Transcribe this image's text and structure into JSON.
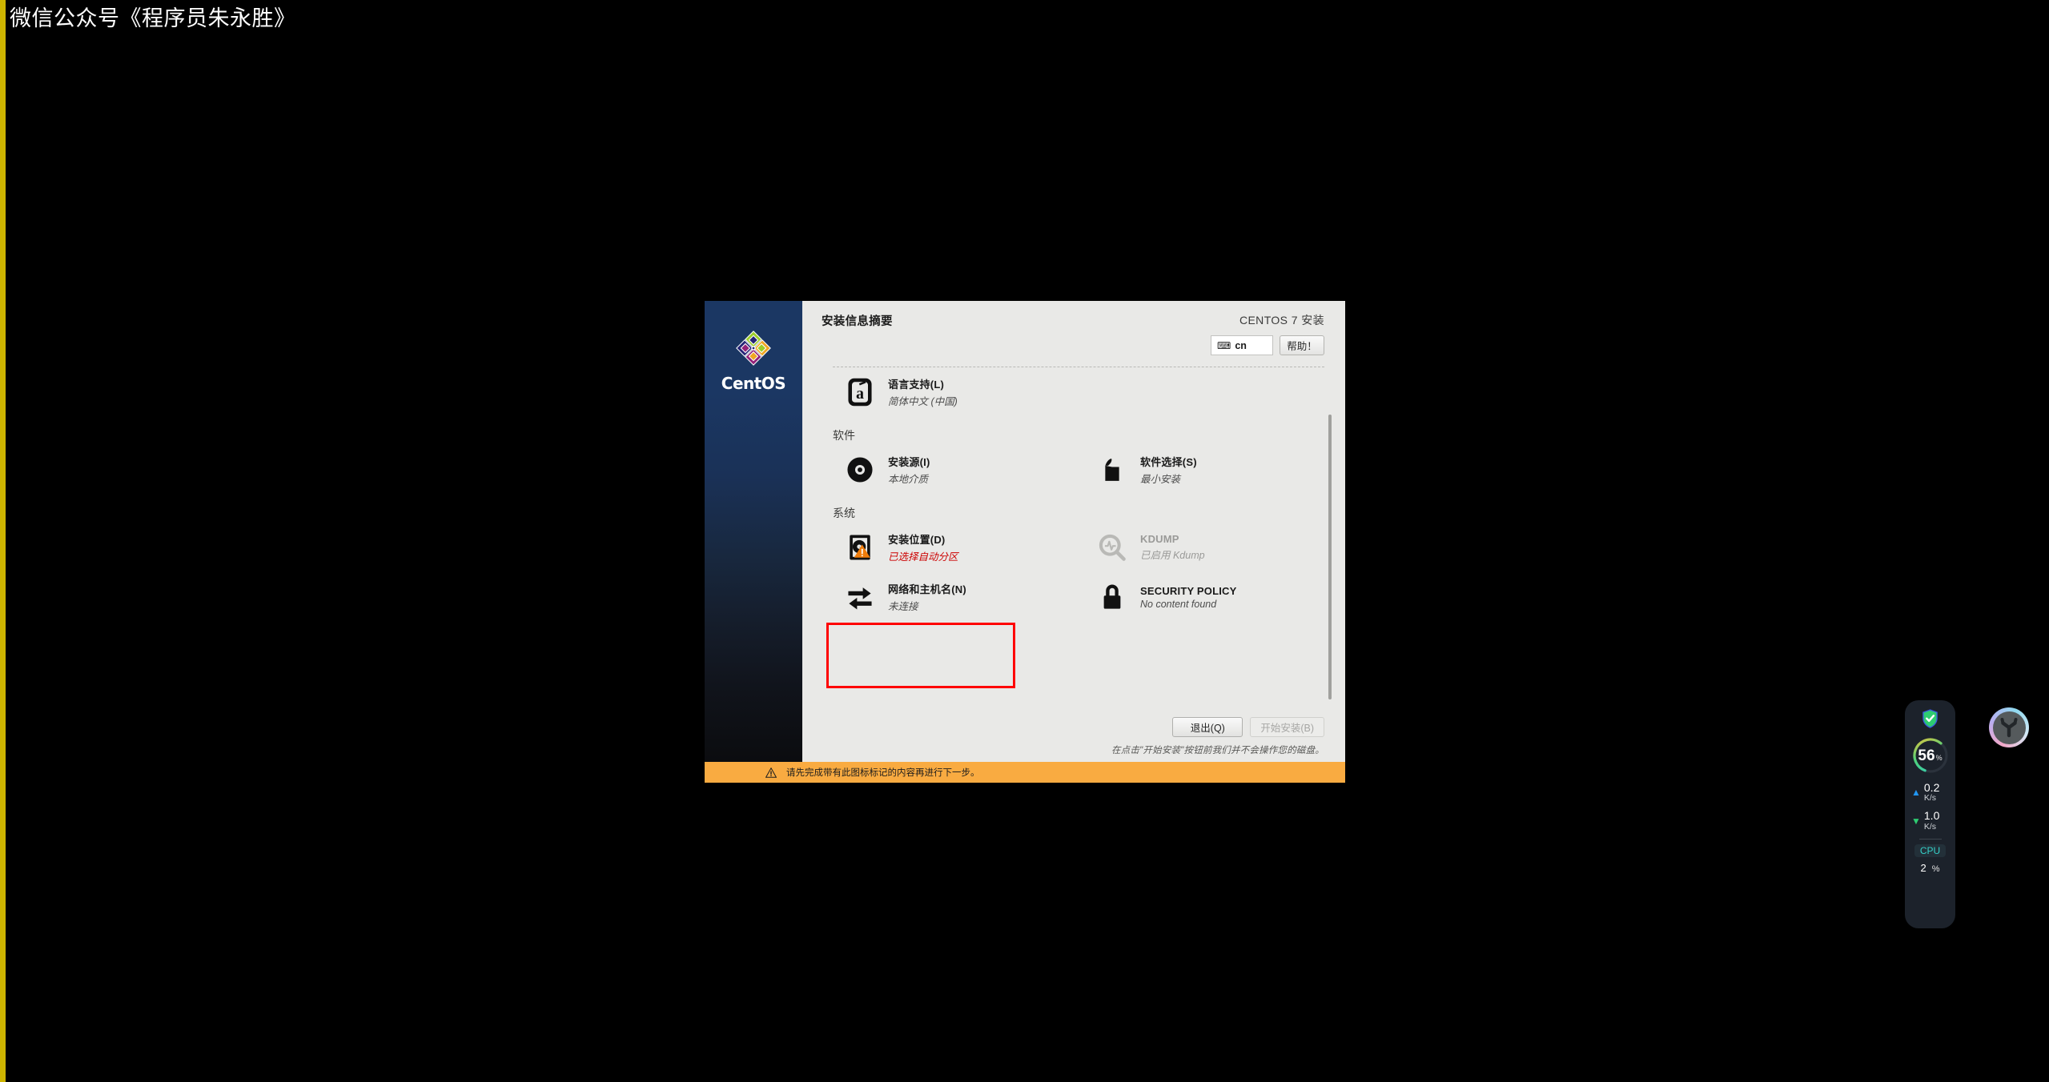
{
  "watermark": "微信公众号《程序员朱永胜》",
  "window": {
    "sidebar": {
      "brand": "CentOS",
      "logo_icon": "centos-logo-icon"
    },
    "header": {
      "title": "安装信息摘要",
      "brand": "CENTOS 7 安装",
      "keyboard_layout": "cn",
      "keyboard_icon": "keyboard-icon",
      "help_label": "帮助！"
    },
    "sections": [
      {
        "id": "localization",
        "title": "",
        "spokes": [
          {
            "id": "language-support",
            "icon": "language-icon",
            "name": "语言支持(L)",
            "status": "简体中文 (中国)",
            "state": "normal"
          }
        ]
      },
      {
        "id": "software",
        "title": "软件",
        "spokes": [
          {
            "id": "installation-source",
            "icon": "disc-icon",
            "name": "安装源(I)",
            "status": "本地介质",
            "state": "normal"
          },
          {
            "id": "software-selection",
            "icon": "package-icon",
            "name": "软件选择(S)",
            "status": "最小安装",
            "state": "normal"
          }
        ]
      },
      {
        "id": "system",
        "title": "系统",
        "spokes": [
          {
            "id": "installation-destination",
            "icon": "harddrive-icon",
            "name": "安装位置(D)",
            "status": "已选择自动分区",
            "state": "warning"
          },
          {
            "id": "kdump",
            "icon": "magnifier-icon",
            "name": "KDUMP",
            "status": "已启用 Kdump",
            "state": "disabled"
          },
          {
            "id": "network-hostname",
            "icon": "network-arrows-icon",
            "name": "网络和主机名(N)",
            "status": "未连接",
            "state": "normal"
          },
          {
            "id": "security-policy",
            "icon": "lock-icon",
            "name": "SECURITY POLICY",
            "status": "No content found",
            "state": "normal"
          }
        ]
      }
    ],
    "footer": {
      "quit_label": "退出(Q)",
      "begin_label": "开始安装(B)",
      "begin_disabled": true,
      "note": "在点击\"开始安装\"按钮前我们并不会操作您的磁盘。"
    },
    "warning_bar": {
      "icon": "warning-triangle-icon",
      "text": "请先完成带有此图标标记的内容再进行下一步。"
    },
    "annotation": {
      "type": "red-highlight-box",
      "target": "network-hostname"
    }
  },
  "monitor_widget": {
    "shield_icon": "shield-check-icon",
    "memory_value": "56",
    "memory_unit": "%",
    "upload_icon": "arrow-up-icon",
    "upload_value": "0.2",
    "upload_unit": "K/s",
    "download_icon": "arrow-down-icon",
    "download_value": "1.0",
    "download_unit": "K/s",
    "cpu_label": "CPU",
    "cpu_value": "2",
    "cpu_unit": "%"
  },
  "orb": {
    "icon": "trident-orb-icon"
  },
  "colors": {
    "accent_orange": "#f9ab41",
    "warning_red": "#cc0000",
    "annotation_red": "#ff0000",
    "sidebar_blue": "#1b3763",
    "edge_stripe": "#cdb400"
  }
}
